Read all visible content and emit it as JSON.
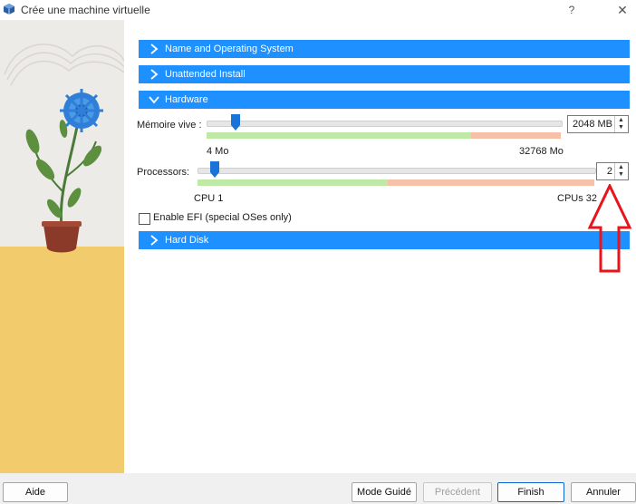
{
  "window": {
    "title": "Crée une machine virtuelle",
    "help": "?",
    "close": "✕"
  },
  "sections": {
    "name_os": "Name and Operating System",
    "unattended": "Unattended Install",
    "hardware": "Hardware",
    "hard_disk": "Hard Disk"
  },
  "memory": {
    "label": "Mémoire vive :",
    "value": "2048 MB",
    "min_label": "4 Mo",
    "max_label": "32768 Mo",
    "level_fraction": 0.0624
  },
  "processors": {
    "label": "Processors:",
    "value": "2",
    "min_label": "CPU 1",
    "max_label": "CPUs 32",
    "level_fraction": 0.03
  },
  "efi": {
    "label": "Enable EFI (special OSes only)",
    "checked": false
  },
  "buttons": {
    "help": "Aide",
    "guided": "Mode Guidé",
    "previous": "Précédent",
    "finish": "Finish",
    "cancel": "Annuler"
  },
  "colors": {
    "accent": "#1e90ff",
    "annotation": "#e8141c"
  }
}
